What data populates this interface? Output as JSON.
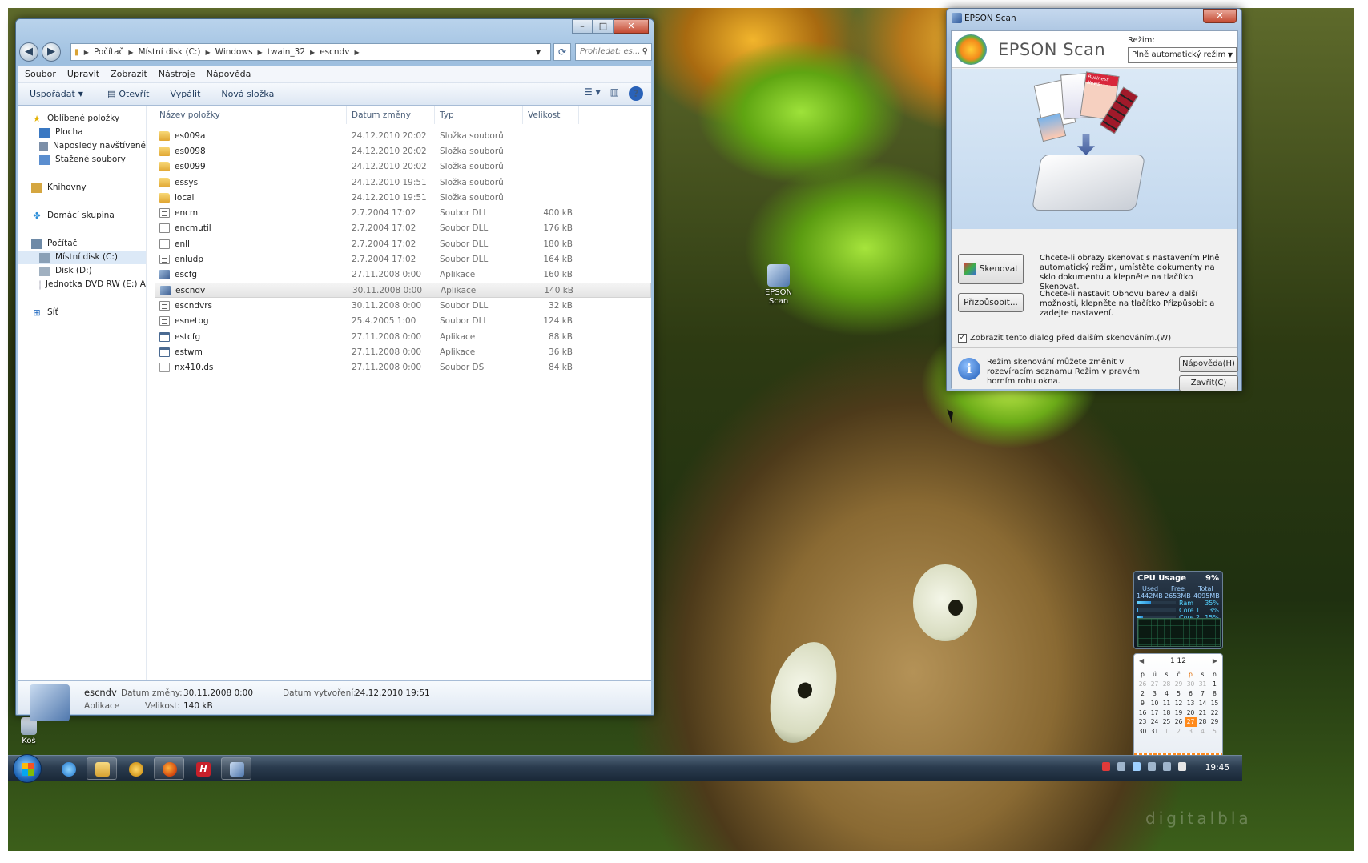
{
  "desktop": {
    "icons": [
      {
        "label": "EPSON\nScan"
      },
      {
        "label": "Koš"
      }
    ],
    "watermark": "digitalbla"
  },
  "explorer": {
    "breadcrumb": [
      "Počítač",
      "Místní disk (C:)",
      "Windows",
      "twain_32",
      "escndv"
    ],
    "search_placeholder": "Prohledat: es...",
    "menu": [
      "Soubor",
      "Upravit",
      "Zobrazit",
      "Nástroje",
      "Nápověda"
    ],
    "toolbar": {
      "organize": "Uspořádat",
      "open": "Otevřít",
      "burn": "Vypálit",
      "new_folder": "Nová složka"
    },
    "nav": {
      "favorites": "Oblíbené položky",
      "fav_items": [
        "Plocha",
        "Naposledy navštívené",
        "Stažené soubory"
      ],
      "libraries": "Knihovny",
      "homegroup": "Domácí skupina",
      "computer": "Počítač",
      "computer_items": [
        "Místní disk (C:)",
        "Disk (D:)",
        "Jednotka DVD RW (E:) A"
      ],
      "network": "Síť"
    },
    "columns": {
      "name": "Název položky",
      "date": "Datum změny",
      "type": "Typ",
      "size": "Velikost"
    },
    "files": [
      {
        "name": "es009a",
        "date": "24.12.2010 20:02",
        "type": "Složka souborů",
        "size": "",
        "icon": "folder"
      },
      {
        "name": "es0098",
        "date": "24.12.2010 20:02",
        "type": "Složka souborů",
        "size": "",
        "icon": "folder"
      },
      {
        "name": "es0099",
        "date": "24.12.2010 20:02",
        "type": "Složka souborů",
        "size": "",
        "icon": "folder"
      },
      {
        "name": "essys",
        "date": "24.12.2010 19:51",
        "type": "Složka souborů",
        "size": "",
        "icon": "folder"
      },
      {
        "name": "local",
        "date": "24.12.2010 19:51",
        "type": "Složka souborů",
        "size": "",
        "icon": "folder"
      },
      {
        "name": "encm",
        "date": "2.7.2004 17:02",
        "type": "Soubor DLL",
        "size": "400 kB",
        "icon": "dll"
      },
      {
        "name": "encmutil",
        "date": "2.7.2004 17:02",
        "type": "Soubor DLL",
        "size": "176 kB",
        "icon": "dll"
      },
      {
        "name": "enll",
        "date": "2.7.2004 17:02",
        "type": "Soubor DLL",
        "size": "180 kB",
        "icon": "dll"
      },
      {
        "name": "enludp",
        "date": "2.7.2004 17:02",
        "type": "Soubor DLL",
        "size": "164 kB",
        "icon": "dll"
      },
      {
        "name": "escfg",
        "date": "27.11.2008 0:00",
        "type": "Aplikace",
        "size": "160 kB",
        "icon": "scan"
      },
      {
        "name": "escndv",
        "date": "30.11.2008 0:00",
        "type": "Aplikace",
        "size": "140 kB",
        "icon": "scan"
      },
      {
        "name": "escndvrs",
        "date": "30.11.2008 0:00",
        "type": "Soubor DLL",
        "size": "32 kB",
        "icon": "dll"
      },
      {
        "name": "esnetbg",
        "date": "25.4.2005 1:00",
        "type": "Soubor DLL",
        "size": "124 kB",
        "icon": "dll"
      },
      {
        "name": "estcfg",
        "date": "27.11.2008 0:00",
        "type": "Aplikace",
        "size": "88 kB",
        "icon": "app"
      },
      {
        "name": "estwm",
        "date": "27.11.2008 0:00",
        "type": "Aplikace",
        "size": "36 kB",
        "icon": "app"
      },
      {
        "name": "nx410.ds",
        "date": "27.11.2008 0:00",
        "type": "Soubor DS",
        "size": "84 kB",
        "icon": "blank"
      }
    ],
    "selected_index": 10,
    "details": {
      "name": "escndv",
      "type": "Aplikace",
      "modified_label": "Datum změny:",
      "modified": "30.11.2008 0:00",
      "size_label": "Velikost:",
      "size": "140 kB",
      "created_label": "Datum vytvoření:",
      "created": "24.12.2010 19:51"
    }
  },
  "epson": {
    "title": "EPSON Scan",
    "brand": "EPSON Scan",
    "mode_label": "Režim:",
    "mode_value": "Plně automatický režim",
    "art_doc_label": "Business News",
    "scan_button": "Skenovat",
    "scan_text": "Chcete-li obrazy skenovat s nastavením Plně automatický režim, umístěte dokumenty na sklo dokumentu a klepněte na tlačítko Skenovat.",
    "customize_button": "Přizpůsobit...",
    "customize_text": "Chcete-li nastavit Obnovu barev a další možnosti, klepněte na tlačítko Přizpůsobit a zadejte nastavení.",
    "checkbox_label": "Zobrazit tento dialog před dalším skenováním.(W)",
    "checkbox_checked": true,
    "info_text": "Režim skenování můžete změnit v rozevíracím seznamu Režim v pravém horním rohu okna.",
    "help_button": "Nápověda(H)",
    "close_button": "Zavřít(C)"
  },
  "cpu_gadget": {
    "title": "CPU Usage",
    "percent": "9%",
    "used_label": "Used",
    "free_label": "Free",
    "total_label": "Total",
    "used": "1442MB",
    "free": "2653MB",
    "total": "4095MB",
    "rows": [
      {
        "label": "Ram",
        "value": "35%",
        "fraction": 0.35
      },
      {
        "label": "Core 1",
        "value": "3%",
        "fraction": 0.03
      },
      {
        "label": "Core 2",
        "value": "15%",
        "fraction": 0.15
      }
    ]
  },
  "calendar": {
    "month": "1 12",
    "weekdays": [
      "p",
      "ú",
      "s",
      "č",
      "p",
      "s",
      "n"
    ],
    "weeks": [
      [
        "26",
        "27",
        "28",
        "29",
        "30",
        "31",
        "1"
      ],
      [
        "2",
        "3",
        "4",
        "5",
        "6",
        "7",
        "8"
      ],
      [
        "9",
        "10",
        "11",
        "12",
        "13",
        "14",
        "15"
      ],
      [
        "16",
        "17",
        "18",
        "19",
        "20",
        "21",
        "22"
      ],
      [
        "23",
        "24",
        "25",
        "26",
        "27",
        "28",
        "29"
      ],
      [
        "30",
        "31",
        "1",
        "2",
        "3",
        "4",
        "5"
      ]
    ],
    "today": "27"
  },
  "taskbar": {
    "clock": "19:45"
  }
}
